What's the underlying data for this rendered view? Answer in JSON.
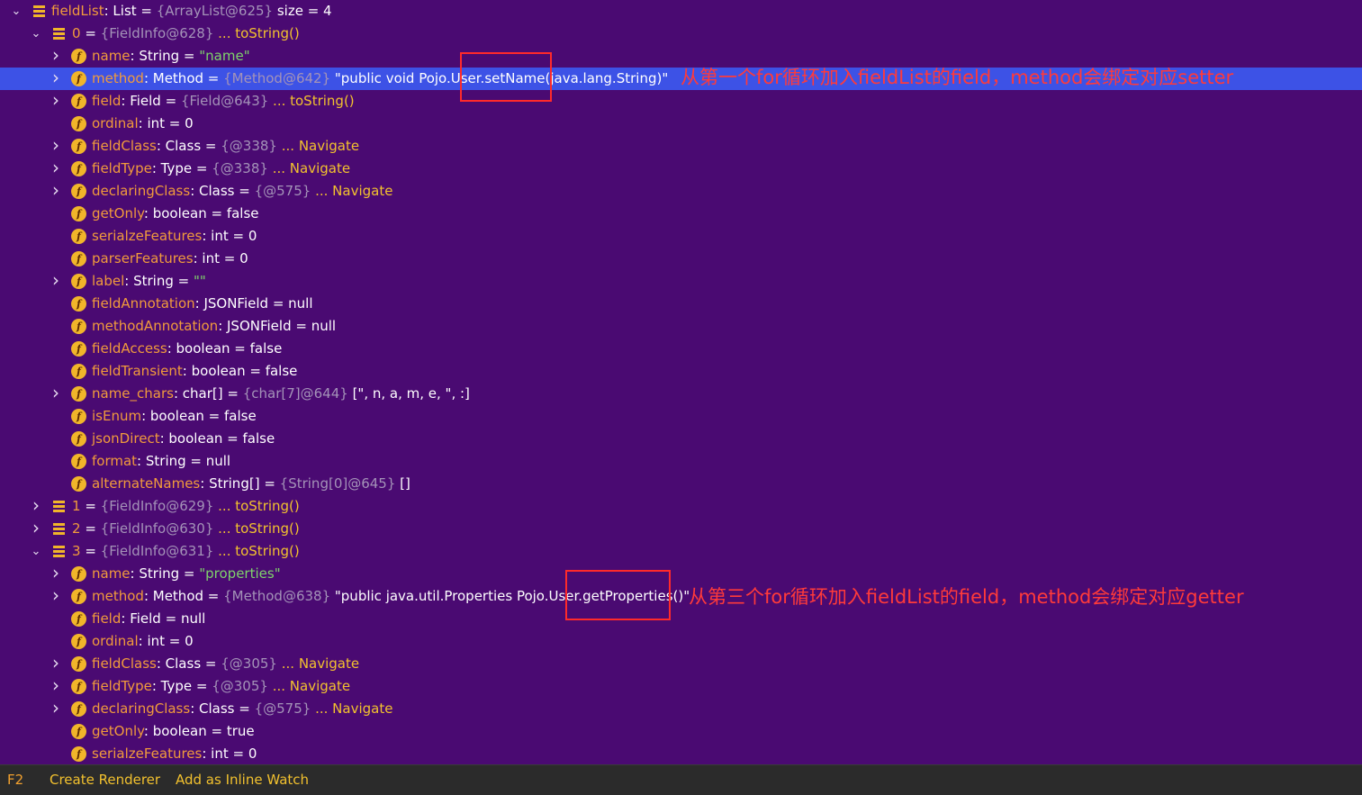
{
  "rows": [
    {
      "arrow": "down",
      "icon": "list",
      "name": "fieldList",
      "type": "List",
      "eq": "=",
      "id": "{ArrayList@625}",
      "value": "size = 4"
    },
    {
      "arrow": "down",
      "icon": "list",
      "name": "0",
      "type": "",
      "eq": "=",
      "id": "{FieldInfo@628}",
      "value": "... toString()"
    },
    {
      "arrow": "right",
      "icon": "field",
      "name": "name",
      "type": "String",
      "eq": "=",
      "id": "",
      "value": "\"name\""
    },
    {
      "arrow": "right",
      "icon": "field",
      "name": "method",
      "type": "Method",
      "eq": "=",
      "id": "{Method@642}",
      "value": "\"public void Pojo.User.setName(java.lang.String)\""
    },
    {
      "arrow": "right",
      "icon": "field",
      "name": "field",
      "type": "Field",
      "eq": "=",
      "id": "{Field@643}",
      "value": "... toString()"
    },
    {
      "arrow": "",
      "icon": "field",
      "name": "ordinal",
      "type": "int",
      "eq": "=",
      "id": "",
      "value": "0"
    },
    {
      "arrow": "right",
      "icon": "field",
      "name": "fieldClass",
      "type": "Class",
      "eq": "=",
      "id": "{@338}",
      "value": "... Navigate"
    },
    {
      "arrow": "right",
      "icon": "field",
      "name": "fieldType",
      "type": "Type",
      "eq": "=",
      "id": "{@338}",
      "value": "... Navigate"
    },
    {
      "arrow": "right",
      "icon": "field",
      "name": "declaringClass",
      "type": "Class",
      "eq": "=",
      "id": "{@575}",
      "value": "... Navigate"
    },
    {
      "arrow": "",
      "icon": "field",
      "name": "getOnly",
      "type": "boolean",
      "eq": "=",
      "id": "",
      "value": "false"
    },
    {
      "arrow": "",
      "icon": "field",
      "name": "serialzeFeatures",
      "type": "int",
      "eq": "=",
      "id": "",
      "value": "0"
    },
    {
      "arrow": "",
      "icon": "field",
      "name": "parserFeatures",
      "type": "int",
      "eq": "=",
      "id": "",
      "value": "0"
    },
    {
      "arrow": "right",
      "icon": "field",
      "name": "label",
      "type": "String",
      "eq": "=",
      "id": "",
      "value": "\"\""
    },
    {
      "arrow": "",
      "icon": "field",
      "name": "fieldAnnotation",
      "type": "JSONField",
      "eq": "=",
      "id": "",
      "value": "null"
    },
    {
      "arrow": "",
      "icon": "field",
      "name": "methodAnnotation",
      "type": "JSONField",
      "eq": "=",
      "id": "",
      "value": "null"
    },
    {
      "arrow": "",
      "icon": "field",
      "name": "fieldAccess",
      "type": "boolean",
      "eq": "=",
      "id": "",
      "value": "false"
    },
    {
      "arrow": "",
      "icon": "field",
      "name": "fieldTransient",
      "type": "boolean",
      "eq": "=",
      "id": "",
      "value": "false"
    },
    {
      "arrow": "right",
      "icon": "field",
      "name": "name_chars",
      "type": "char[]",
      "eq": "=",
      "id": "{char[7]@644}",
      "value": "[\", n, a, m, e, \", :]"
    },
    {
      "arrow": "",
      "icon": "field",
      "name": "isEnum",
      "type": "boolean",
      "eq": "=",
      "id": "",
      "value": "false"
    },
    {
      "arrow": "",
      "icon": "field",
      "name": "jsonDirect",
      "type": "boolean",
      "eq": "=",
      "id": "",
      "value": "false"
    },
    {
      "arrow": "",
      "icon": "field",
      "name": "format",
      "type": "String",
      "eq": "=",
      "id": "",
      "value": "null"
    },
    {
      "arrow": "",
      "icon": "field",
      "name": "alternateNames",
      "type": "String[]",
      "eq": "=",
      "id": "{String[0]@645}",
      "value": "[]"
    },
    {
      "arrow": "right",
      "icon": "list",
      "name": "1",
      "type": "",
      "eq": "=",
      "id": "{FieldInfo@629}",
      "value": "... toString()"
    },
    {
      "arrow": "right",
      "icon": "list",
      "name": "2",
      "type": "",
      "eq": "=",
      "id": "{FieldInfo@630}",
      "value": "... toString()"
    },
    {
      "arrow": "down",
      "icon": "list",
      "name": "3",
      "type": "",
      "eq": "=",
      "id": "{FieldInfo@631}",
      "value": "... toString()"
    },
    {
      "arrow": "right",
      "icon": "field",
      "name": "name",
      "type": "String",
      "eq": "=",
      "id": "",
      "value": "\"properties\""
    },
    {
      "arrow": "right",
      "icon": "field",
      "name": "method",
      "type": "Method",
      "eq": "=",
      "id": "{Method@638}",
      "value": "\"public java.util.Properties Pojo.User.getProperties()\""
    },
    {
      "arrow": "",
      "icon": "field",
      "name": "field",
      "type": "Field",
      "eq": "=",
      "id": "",
      "value": "null"
    },
    {
      "arrow": "",
      "icon": "field",
      "name": "ordinal",
      "type": "int",
      "eq": "=",
      "id": "",
      "value": "0"
    },
    {
      "arrow": "right",
      "icon": "field",
      "name": "fieldClass",
      "type": "Class",
      "eq": "=",
      "id": "{@305}",
      "value": "... Navigate"
    },
    {
      "arrow": "right",
      "icon": "field",
      "name": "fieldType",
      "type": "Type",
      "eq": "=",
      "id": "{@305}",
      "value": "... Navigate"
    },
    {
      "arrow": "right",
      "icon": "field",
      "name": "declaringClass",
      "type": "Class",
      "eq": "=",
      "id": "{@575}",
      "value": "... Navigate"
    },
    {
      "arrow": "",
      "icon": "field",
      "name": "getOnly",
      "type": "boolean",
      "eq": "=",
      "id": "",
      "value": "true"
    },
    {
      "arrow": "",
      "icon": "field",
      "name": "serialzeFeatures",
      "type": "int",
      "eq": "=",
      "id": "",
      "value": "0"
    }
  ],
  "annotations": [
    {
      "text": "从第一个for循环加入fieldList的field，method会绑定对应setter"
    },
    {
      "text": "从第三个for循环加入fieldList的field，method会绑定对应getter"
    }
  ],
  "bottom_bar": {
    "key": "F2",
    "create_renderer": "Create Renderer",
    "add_inline_watch": "Add as Inline Watch"
  },
  "colors": {
    "background": "#4a0a72",
    "selected_row": "#3d52e6",
    "field_name": "#f19b3c",
    "string_value": "#7fd36b",
    "link": "#f2c12e",
    "annotation": "#ff3a3a"
  }
}
